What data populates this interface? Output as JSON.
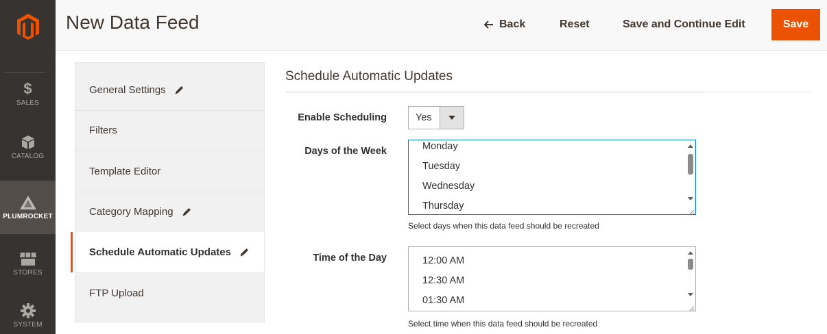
{
  "nav": {
    "items": [
      {
        "label": "Sales",
        "icon": "dollar-icon"
      },
      {
        "label": "Catalog",
        "icon": "cube-icon"
      },
      {
        "label": "Plumrocket",
        "icon": "plumrocket-icon"
      },
      {
        "label": "Stores",
        "icon": "store-icon"
      },
      {
        "label": "System",
        "icon": "gear-icon"
      }
    ]
  },
  "header": {
    "title": "New Data Feed",
    "back_label": "Back",
    "reset_label": "Reset",
    "save_continue_label": "Save and Continue Edit",
    "save_label": "Save"
  },
  "tabs": [
    {
      "label": "General Settings",
      "edited": true
    },
    {
      "label": "Filters",
      "edited": false
    },
    {
      "label": "Template Editor",
      "edited": false
    },
    {
      "label": "Category Mapping",
      "edited": true
    },
    {
      "label": "Schedule Automatic Updates",
      "edited": true,
      "active": true
    },
    {
      "label": "FTP Upload",
      "edited": false
    }
  ],
  "section": {
    "title": "Schedule Automatic Updates",
    "enable_scheduling": {
      "label": "Enable Scheduling",
      "value": "Yes"
    },
    "days": {
      "label": "Days of the Week",
      "options": [
        "Monday",
        "Tuesday",
        "Wednesday",
        "Thursday"
      ],
      "note": "Select days when this data feed should be recreated"
    },
    "time": {
      "label": "Time of the Day",
      "options": [
        "12:00 AM",
        "12:30 AM",
        "01:30 AM"
      ],
      "note": "Select time when this data feed should be recreated"
    }
  },
  "colors": {
    "accent": "#eb5202",
    "nav_bg": "#373330",
    "focus": "#007bdb"
  }
}
